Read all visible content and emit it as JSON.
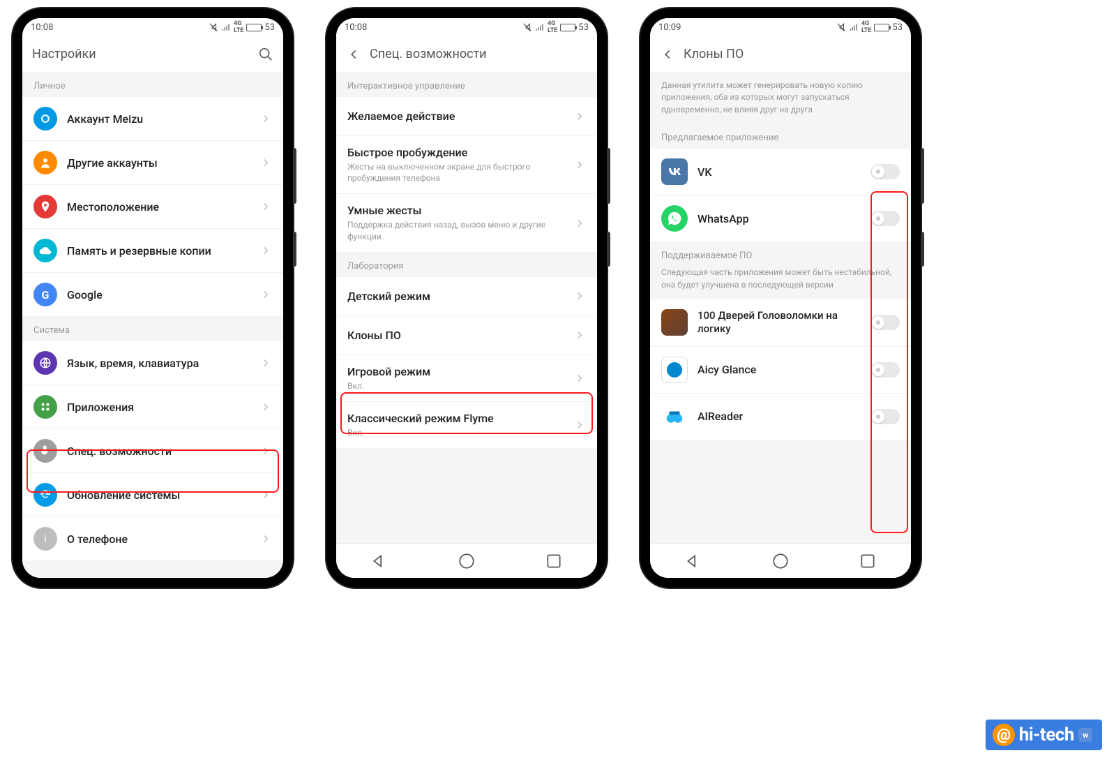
{
  "status": {
    "battery": "53"
  },
  "phone1": {
    "time": "10:08",
    "title": "Настройки",
    "sections": [
      {
        "header": "Личное",
        "items": [
          {
            "label": "Аккаунт Meizu",
            "icon": "meizu",
            "color": "c-blue"
          },
          {
            "label": "Другие аккаунты",
            "icon": "user",
            "color": "c-orange"
          },
          {
            "label": "Местоположение",
            "icon": "pin",
            "color": "c-red"
          },
          {
            "label": "Память и резервные копии",
            "icon": "cloud",
            "color": "c-teal"
          },
          {
            "label": "Google",
            "icon": "g",
            "color": "c-gblue"
          }
        ]
      },
      {
        "header": "Система",
        "items": [
          {
            "label": "Язык, время, клавиатура",
            "icon": "globe",
            "color": "c-purple"
          },
          {
            "label": "Приложения",
            "icon": "apps",
            "color": "c-green"
          },
          {
            "label": "Спец. возможности",
            "icon": "hand",
            "color": "c-grey",
            "highlighted": true
          },
          {
            "label": "Обновление системы",
            "icon": "refresh",
            "color": "c-cyan"
          },
          {
            "label": "О телефоне",
            "icon": "info",
            "color": "c-lightgrey"
          }
        ]
      }
    ]
  },
  "phone2": {
    "time": "10:08",
    "title": "Спец. возможности",
    "sections": [
      {
        "header": "Интерактивное управление",
        "items": [
          {
            "label": "Желаемое действие"
          },
          {
            "label": "Быстрое пробуждение",
            "sub": "Жесты на выключенном экране для быстрого пробуждения телефона"
          },
          {
            "label": "Умные жесты",
            "sub": "Поддержка действия назад, вызов меню и другие функции"
          }
        ]
      },
      {
        "header": "Лаборатория",
        "items": [
          {
            "label": "Детский режим"
          },
          {
            "label": "Клоны ПО",
            "highlighted": true
          },
          {
            "label": "Игровой режим",
            "sub": "Вкл."
          },
          {
            "label": "Классический режим Flyme",
            "sub": "Вкл."
          }
        ]
      }
    ]
  },
  "phone3": {
    "time": "10:09",
    "title": "Клоны ПО",
    "desc": "Данная утилита может генерировать новую копию приложения, оба из которых могут запускаться одновременно, не влияя друг на друга",
    "sec1_header": "Предлагаемое приложение",
    "sec1": [
      {
        "label": "VK",
        "app": "vk"
      },
      {
        "label": "WhatsApp",
        "app": "wa"
      }
    ],
    "sec2_header": "Поддерживаемое ПО",
    "sec2_desc": "Следующая часть приложения может быть нестабильной, она будет улучшена в последующей версии",
    "sec2": [
      {
        "label": "100 Дверей Головоломки на логику",
        "app": "doors"
      },
      {
        "label": "Aicy Glance",
        "app": "aicy"
      },
      {
        "label": "AlReader",
        "app": "alr"
      }
    ]
  },
  "watermark": {
    "text": "hi-tech"
  }
}
